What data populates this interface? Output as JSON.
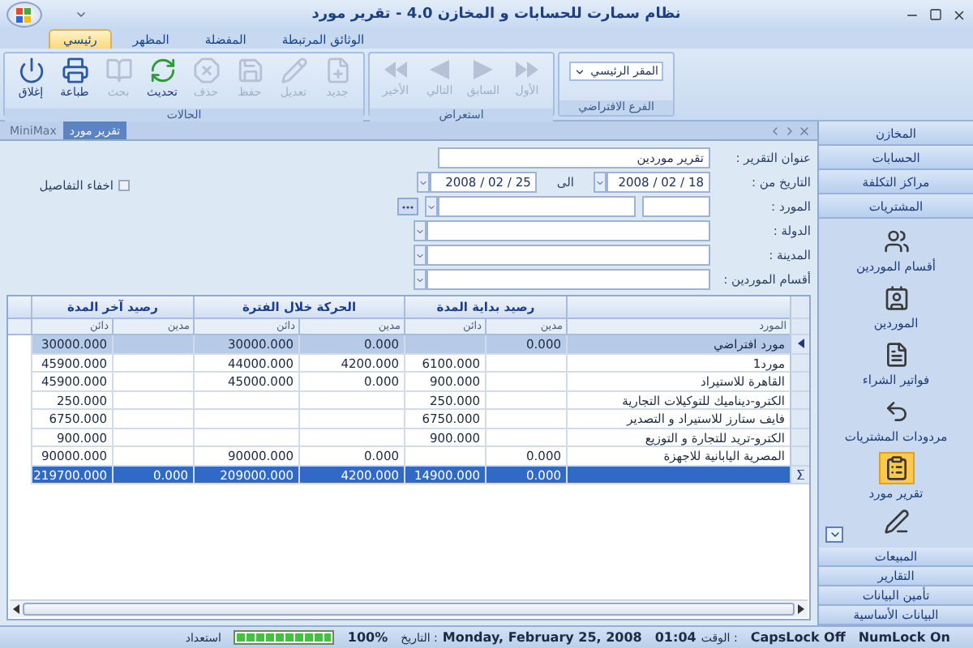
{
  "window": {
    "title": "نظام سمارت للحسابات و المخازن 4.0 - تقرير مورد"
  },
  "ribbon": {
    "tabs": [
      {
        "label": "الوثائق المرتبطة",
        "selected": false
      },
      {
        "label": "المفضلة",
        "selected": false
      },
      {
        "label": "المظهر",
        "selected": false
      },
      {
        "label": "رئيسي",
        "selected": true
      }
    ],
    "groups": [
      {
        "kind": "dropdown",
        "label": "الفرع الافتراضي",
        "value": "المقر الرئيسي"
      },
      {
        "kind": "nav",
        "label": "استعراض",
        "buttons": [
          {
            "label": "الأول",
            "disabled": true
          },
          {
            "label": "السابق",
            "disabled": true
          },
          {
            "label": "التالي",
            "disabled": true
          },
          {
            "label": "الأخير",
            "disabled": true
          }
        ]
      },
      {
        "kind": "actions",
        "label": "الحالات",
        "buttons": [
          {
            "label": "جديد",
            "disabled": true
          },
          {
            "label": "تعديل",
            "disabled": true
          },
          {
            "label": "حفظ",
            "disabled": true
          },
          {
            "label": "حذف",
            "disabled": true
          },
          {
            "label": "تحديث",
            "disabled": false
          },
          {
            "label": "بحث",
            "disabled": true
          },
          {
            "label": "طباعة",
            "disabled": false
          },
          {
            "label": "إغلاق",
            "disabled": false
          }
        ]
      }
    ]
  },
  "doc_tabs": [
    {
      "label": "تقرير مورد",
      "selected": true
    },
    {
      "label": "MiniMax",
      "selected": false
    }
  ],
  "form": {
    "fields": [
      {
        "kind": "text",
        "label": "عنوان التقرير :",
        "value": "تقرير موردين"
      },
      {
        "kind": "date_range",
        "label": "التاريخ  من :",
        "from": "2008 / 02 / 18",
        "to_label": "الى",
        "to": "2008 / 02 / 25"
      },
      {
        "kind": "lookup",
        "label": "المورد :"
      },
      {
        "kind": "combo",
        "label": "الدولة :"
      },
      {
        "kind": "combo",
        "label": "المدينة :"
      },
      {
        "kind": "combo",
        "label": "أقسام الموردين :"
      }
    ],
    "hide_details": {
      "label": "اخفاء التفاصيل",
      "checked": false
    }
  },
  "grid": {
    "groups": [
      "رصيد بداية المدة",
      "الحركة خلال الفترة",
      "رصيد آخر المدة"
    ],
    "columns": [
      "المورد",
      "مدين",
      "دائن",
      "مدين",
      "دائن",
      "مدين",
      "دائن"
    ],
    "rows": [
      {
        "selected": true,
        "cells": {
          "supplier": "مورد افتراضي",
          "begin_debit": "0.000",
          "period_debit": "0.000",
          "period_credit": "30000.000",
          "end_credit": "30000.000"
        }
      },
      {
        "selected": false,
        "cells": {
          "supplier": "مورد1",
          "begin_credit": "6100.000",
          "period_debit": "4200.000",
          "period_credit": "44000.000",
          "end_credit": "45900.000"
        }
      },
      {
        "selected": false,
        "cells": {
          "supplier": "القاهرة للاستيراد",
          "begin_credit": "900.000",
          "period_debit": "0.000",
          "period_credit": "45000.000",
          "end_credit": "45900.000"
        }
      },
      {
        "selected": false,
        "cells": {
          "supplier": "الكترو-ديناميك للتوكيلات التجارية",
          "begin_credit": "250.000",
          "end_credit": "250.000"
        }
      },
      {
        "selected": false,
        "cells": {
          "supplier": "فايف ستارز للاستيراد و التصدير",
          "begin_credit": "6750.000",
          "end_credit": "6750.000"
        }
      },
      {
        "selected": false,
        "cells": {
          "supplier": "الكترو-تريد للتجارة و التوزيع",
          "begin_credit": "900.000",
          "end_credit": "900.000"
        }
      },
      {
        "selected": false,
        "cells": {
          "supplier": "المصرية اليابانية للاجهزة",
          "begin_debit": "0.000",
          "period_debit": "0.000",
          "period_credit": "90000.000",
          "end_credit": "90000.000"
        }
      }
    ],
    "totals": {
      "begin_debit": "0.000",
      "begin_credit": "14900.000",
      "period_debit": "4200.000",
      "period_credit": "209000.000",
      "end_debit": "0.000",
      "end_credit": "219700.000"
    }
  },
  "sidebar": {
    "top": [
      "المخازن",
      "الحسابات",
      "مراكز التكلفة",
      "المشتريات"
    ],
    "items": [
      {
        "label": "أقسام الموردين",
        "selected": false
      },
      {
        "label": "الموردين",
        "selected": false
      },
      {
        "label": "فواتير الشراء",
        "selected": false
      },
      {
        "label": "مردودات المشتريات",
        "selected": false
      },
      {
        "label": "تقرير مورد",
        "selected": true
      }
    ],
    "bottom": [
      "المبيعات",
      "التقارير",
      "تأمين البيانات",
      "البيانات الأساسية"
    ]
  },
  "status_bar": {
    "numlock": "NumLock On",
    "capslock": "CapsLock Off",
    "time_label": "الوقت :",
    "time": "01:04",
    "date": "Monday, February 25, 2008",
    "date_label": "التاريخ :",
    "zoom": "100%",
    "progress": {
      "level": 1
    },
    "state": "استعداد"
  }
}
